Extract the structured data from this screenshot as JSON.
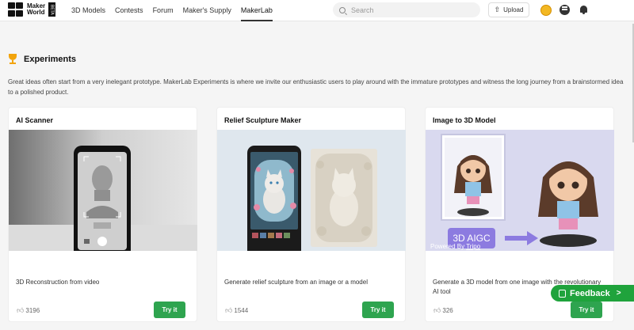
{
  "nav": {
    "logo_line1": "Maker",
    "logo_line2": "World",
    "beta": "BETA",
    "links": [
      {
        "label": "3D Models"
      },
      {
        "label": "Contests"
      },
      {
        "label": "Forum"
      },
      {
        "label": "Maker's Supply"
      },
      {
        "label": "MakerLab"
      }
    ],
    "active_link": "MakerLab",
    "search_placeholder": "Search",
    "upload_label": "Upload"
  },
  "section": {
    "title": "Experiments",
    "description": "Great ideas often start from a very inelegant prototype. MakerLab Experiments is where we invite our enthusiastic users to play around with the immature prototypes and witness the long journey from a brainstormed idea to a polished product."
  },
  "cards": [
    {
      "title": "AI Scanner",
      "description": "3D Reconstruction from video",
      "likes": "3196",
      "button": "Try it"
    },
    {
      "title": "Relief Sculpture Maker",
      "description": "Generate relief sculpture from an image or a model",
      "likes": "1544",
      "button": "Try it"
    },
    {
      "title": "Image to 3D Model",
      "description": "Generate a 3D model from one image with the revolutionary AI tool",
      "likes": "326",
      "button": "Try it",
      "image_badge": "3D AIGC",
      "image_caption_prefix": "Powered By ",
      "image_caption_brand": "Tripo"
    }
  ],
  "feedback_label": "Feedback",
  "colors": {
    "accent_green": "#2ea44f",
    "feedback_green": "#1fa33c",
    "trophy": "#f2a40c"
  },
  "icons": [
    "logo-icon",
    "search-icon",
    "upload-icon",
    "coin-icon",
    "chat-icon",
    "bell-icon",
    "trophy-icon",
    "thumbs-up-icon",
    "feedback-icon",
    "chevron-right-icon"
  ]
}
